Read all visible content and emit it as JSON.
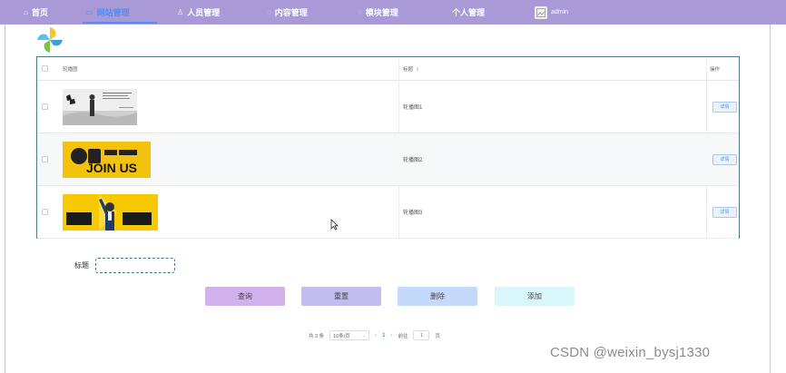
{
  "nav": {
    "items": [
      {
        "icon": "home-icon",
        "glyph": "⌂",
        "label": "首页"
      },
      {
        "icon": "web-icon",
        "glyph": "▭",
        "label": "网站管理"
      },
      {
        "icon": "user-icon",
        "glyph": "♙",
        "label": "人员管理"
      },
      {
        "icon": "content-icon",
        "glyph": "◌",
        "label": "内容管理"
      },
      {
        "icon": "module-icon",
        "glyph": "◌",
        "label": "模块管理"
      },
      {
        "icon": "personal-icon",
        "glyph": "",
        "label": "个人管理"
      }
    ],
    "active_index": 1,
    "user": {
      "name": "admin"
    },
    "colors": {
      "bar": "#a99ad7",
      "active": "#4f8ff7"
    }
  },
  "table": {
    "headers": {
      "image": "轮播图",
      "title": "标题",
      "action": "操作"
    },
    "rows": [
      {
        "image": "carousel-ink-painting",
        "title": "轮播图1",
        "action": "详情"
      },
      {
        "image": "carousel-join-us",
        "title": "轮播图2",
        "action": "详情"
      },
      {
        "image": "carousel-job-poster",
        "title": "轮播图3",
        "action": "详情"
      }
    ]
  },
  "search": {
    "label": "标题",
    "value": "",
    "placeholder": ""
  },
  "buttons": {
    "query": "查询",
    "reset": "重置",
    "delete": "删除",
    "add": "添加"
  },
  "pagination": {
    "total": "共 3 条",
    "page_size": "10条/页",
    "current_page": "1",
    "goto_label": "前往",
    "goto_value": "1",
    "page_unit": "页"
  },
  "watermark": "CSDN @weixin_bysj1330"
}
